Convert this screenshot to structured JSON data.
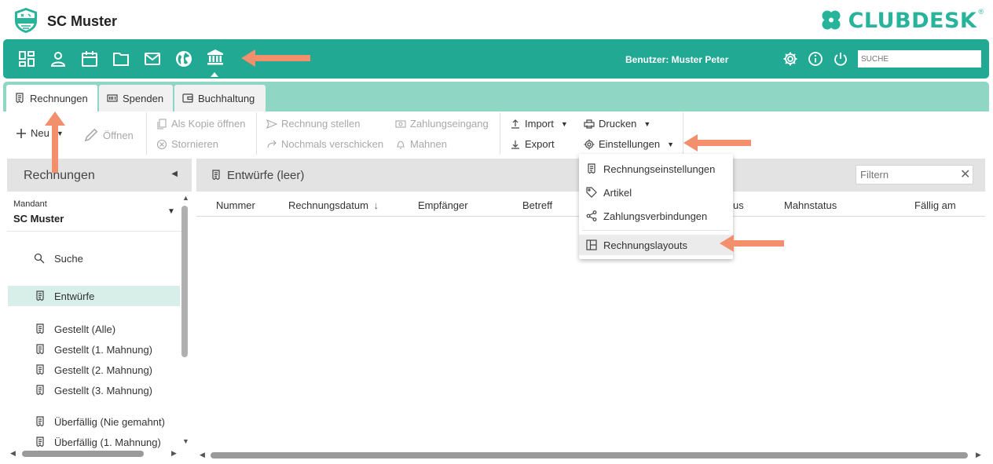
{
  "app": {
    "title": "SC Muster",
    "badge_text": "SC MUSTER",
    "brand": "CLUBDESK",
    "brand_reg": "®"
  },
  "navbar": {
    "icons": [
      "dashboard-icon",
      "person-icon",
      "calendar-icon",
      "folder-icon",
      "mail-icon",
      "globe-icon",
      "bank-icon"
    ],
    "active_icon": "bank-icon",
    "user_label": "Benutzer: Muster Peter",
    "search_placeholder": "SUCHE",
    "right_icons": [
      "gear-icon",
      "info-icon",
      "power-icon"
    ]
  },
  "tabs": [
    {
      "label": "Rechnungen",
      "icon": "invoice-icon",
      "active": true
    },
    {
      "label": "Spenden",
      "icon": "barcode-icon",
      "active": false
    },
    {
      "label": "Buchhaltung",
      "icon": "wallet-icon",
      "active": false
    }
  ],
  "toolbar": {
    "new_label": "Neu",
    "open_label": "Öffnen",
    "copy_label": "Als Kopie öffnen",
    "cancel_label": "Stornieren",
    "issue_label": "Rechnung stellen",
    "resend_label": "Nochmals verschicken",
    "payment_label": "Zahlungseingang",
    "remind_label": "Mahnen",
    "import_label": "Import",
    "export_label": "Export",
    "print_label": "Drucken",
    "settings_label": "Einstellungen"
  },
  "sidebar": {
    "title": "Rechnungen",
    "mandant_label": "Mandant",
    "mandant_value": "SC Muster",
    "items": [
      {
        "label": "Suche",
        "icon": "search-icon",
        "active": false
      },
      {
        "label": "Entwürfe",
        "icon": "invoice-icon",
        "active": true
      },
      {
        "label": "Gestellt (Alle)",
        "icon": "invoice-icon",
        "active": false
      },
      {
        "label": "Gestellt (1. Mahnung)",
        "icon": "invoice-icon",
        "active": false
      },
      {
        "label": "Gestellt (2. Mahnung)",
        "icon": "invoice-icon",
        "active": false
      },
      {
        "label": "Gestellt (3. Mahnung)",
        "icon": "invoice-icon",
        "active": false
      },
      {
        "label": "Überfällig (Nie gemahnt)",
        "icon": "invoice-icon",
        "active": false
      },
      {
        "label": "Überfällig (1. Mahnung)",
        "icon": "invoice-icon",
        "active": false
      }
    ]
  },
  "main": {
    "title": "Entwürfe (leer)",
    "filter_placeholder": "Filtern",
    "columns": [
      "Nummer",
      "Rechnungsdatum",
      "Empfänger",
      "Betreff",
      "us",
      "Mahnstatus",
      "Fällig am"
    ],
    "sort_indicator": "↓"
  },
  "dropdown": {
    "items": [
      {
        "label": "Rechnungseinstellungen",
        "icon": "invoice-icon"
      },
      {
        "label": "Artikel",
        "icon": "tag-icon"
      },
      {
        "label": "Zahlungsverbindungen",
        "icon": "share-icon"
      },
      {
        "label": "Rechnungslayouts",
        "icon": "layout-icon"
      }
    ]
  },
  "colors": {
    "brand_green": "#22a994",
    "tab_bar": "#8fd6c4",
    "arrow": "#f2906e",
    "active_row": "#d8efe9"
  }
}
